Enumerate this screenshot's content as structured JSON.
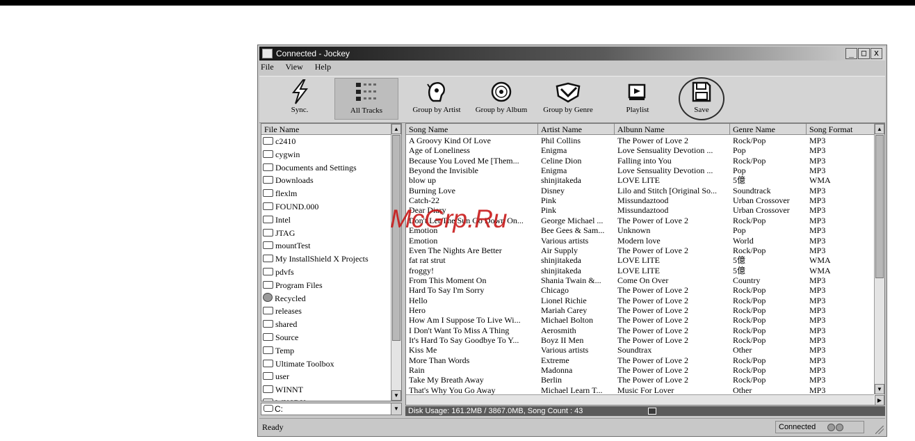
{
  "window": {
    "title": "Connected - Jockey",
    "controls": [
      "_",
      "□",
      "x"
    ]
  },
  "menu": [
    "File",
    "View",
    "Help"
  ],
  "toolbar": [
    {
      "label": "Sync.",
      "icon": "lightning-icon"
    },
    {
      "label": "All Tracks",
      "icon": "all-tracks-icon",
      "selected": true
    },
    {
      "label": "Group by Artist",
      "icon": "artist-icon"
    },
    {
      "label": "Group by Album",
      "icon": "album-icon"
    },
    {
      "label": "Group by Genre",
      "icon": "genre-icon"
    },
    {
      "label": "Playlist",
      "icon": "playlist-icon"
    },
    {
      "label": "Save",
      "icon": "save-icon",
      "highlighted": true
    }
  ],
  "filepane": {
    "header": "File Name",
    "folders": [
      "c2410",
      "cygwin",
      "Documents and Settings",
      "Downloads",
      "flexlm",
      "FOUND.000",
      "Intel",
      "JTAG",
      "mountTest",
      "My InstallShield X Projects",
      "pdvfs",
      "Program Files",
      "Recycled",
      "releases",
      "shared",
      "Source",
      "Temp",
      "Ultimate Toolbox",
      "user",
      "WINNT",
      "WKSDK"
    ],
    "drive": "C:"
  },
  "songs": {
    "headers": [
      "Song Name",
      "Artist Name",
      "Albunn Name",
      "Genre Name",
      "Song Format"
    ],
    "rows": [
      [
        "A Groovy Kind Of Love",
        "Phil Collins",
        "The Power of Love 2",
        "Rock/Pop",
        "MP3"
      ],
      [
        "Age of Loneliness",
        "Enigma",
        "Love Sensuality Devotion ...",
        "Pop",
        "MP3"
      ],
      [
        "Because You Loved Me [Them...",
        "Celine Dion",
        "Falling into You",
        "Rock/Pop",
        "MP3"
      ],
      [
        "Beyond the Invisible",
        "Enigma",
        "Love Sensuality Devotion ...",
        "Pop",
        "MP3"
      ],
      [
        "blow up",
        "shinjitakeda",
        "LOVE LITE",
        "5億",
        "WMA"
      ],
      [
        "Burning Love",
        "Disney",
        "Lilo and Stitch [Original So...",
        "Soundtrack",
        "MP3"
      ],
      [
        "Catch-22",
        "Pink",
        "Missundaztood",
        "Urban Crossover",
        "MP3"
      ],
      [
        "Dear Diary",
        "Pink",
        "Missundaztood",
        "Urban Crossover",
        "MP3"
      ],
      [
        "Don't Let The Sun Go Down On...",
        "George Michael ...",
        "The Power of Love 2",
        "Rock/Pop",
        "MP3"
      ],
      [
        "Emotion",
        "Bee Gees & Sam...",
        "Unknown",
        "Pop",
        "MP3"
      ],
      [
        "Emotion",
        "Various artists",
        "Modern love",
        "World",
        "MP3"
      ],
      [
        "Even The Nights Are Better",
        "Air Supply",
        "The Power of Love 2",
        "Rock/Pop",
        "MP3"
      ],
      [
        "fat rat strut",
        "shinjitakeda",
        "LOVE LITE",
        "5億",
        "WMA"
      ],
      [
        "froggy!",
        "shinjitakeda",
        "LOVE LITE",
        "5億",
        "WMA"
      ],
      [
        "From This Moment On",
        "Shania Twain &...",
        "Come On Over",
        "Country",
        "MP3"
      ],
      [
        "Hard To Say I'm Sorry",
        "Chicago",
        "The Power of Love 2",
        "Rock/Pop",
        "MP3"
      ],
      [
        "Hello",
        "Lionel Richie",
        "The Power of Love 2",
        "Rock/Pop",
        "MP3"
      ],
      [
        "Hero",
        "Mariah Carey",
        "The Power of Love 2",
        "Rock/Pop",
        "MP3"
      ],
      [
        "How Am I Suppose To Live Wi...",
        "Michael Bolton",
        "The Power of Love 2",
        "Rock/Pop",
        "MP3"
      ],
      [
        "I Don't Want To Miss A Thing",
        "Aerosmith",
        "The Power of Love 2",
        "Rock/Pop",
        "MP3"
      ],
      [
        "It's Hard To Say Goodbye To Y...",
        "Boyz II Men",
        "The Power of Love 2",
        "Rock/Pop",
        "MP3"
      ],
      [
        "Kiss Me",
        "Various artists",
        "Soundtrax",
        "Other",
        "MP3"
      ],
      [
        "More Than Words",
        "Extreme",
        "The Power of Love 2",
        "Rock/Pop",
        "MP3"
      ],
      [
        "Rain",
        "Madonna",
        "The Power of Love 2",
        "Rock/Pop",
        "MP3"
      ],
      [
        "Take My Breath Away",
        "Berlin",
        "The Power of Love 2",
        "Rock/Pop",
        "MP3"
      ],
      [
        "That's Why You Go Away",
        "Michael Learn T...",
        "Music For Lover",
        "Other",
        "MP3"
      ]
    ]
  },
  "disk_usage": "Disk Usage: 161.2MB / 3867.0MB, Song Count : 43",
  "status": {
    "text": "Ready",
    "connection": "Connected"
  },
  "watermark": "McGrp.Ru"
}
